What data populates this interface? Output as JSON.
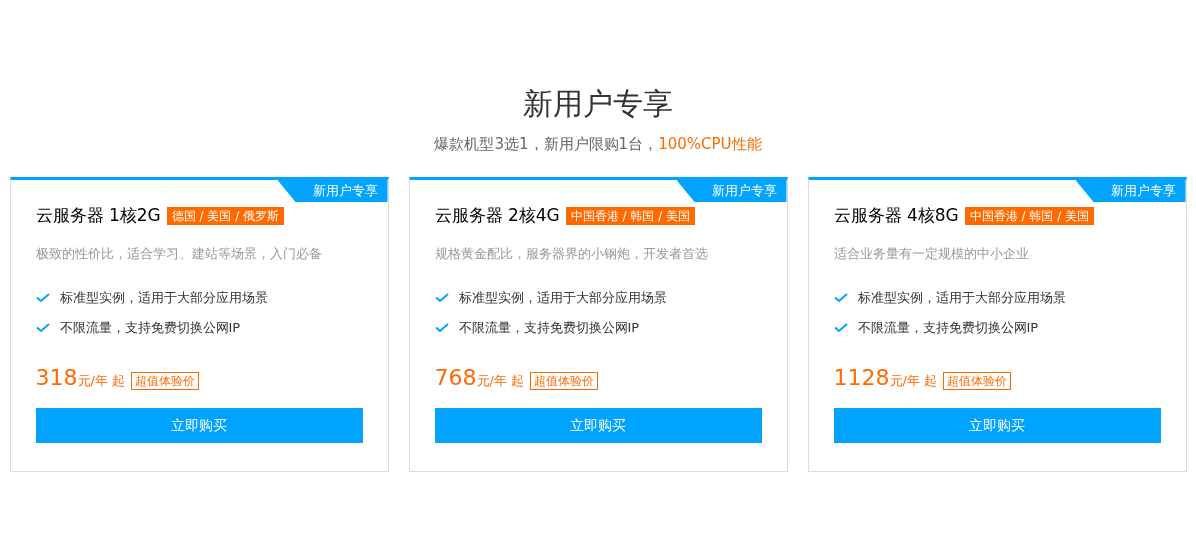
{
  "header": {
    "title": "新用户专享",
    "subtitle": "爆款机型3选1，新用户限购1台，",
    "subtitle_highlight": "100%CPU性能"
  },
  "plans": [
    {
      "ribbon": "新用户专享",
      "name": "云服务器 1核2G",
      "regions": "德国 / 美国 / 俄罗斯",
      "description": "极致的性价比，适合学习、建站等场景，入门必备",
      "features": [
        "标准型实例，适用于大部分应用场景",
        "不限流量，支持免费切换公网IP"
      ],
      "price": "318",
      "unit": "元/年 起",
      "price_tag": "超值体验价",
      "button": "立即购买"
    },
    {
      "ribbon": "新用户专享",
      "name": "云服务器 2核4G",
      "regions": "中国香港 / 韩国 / 美国",
      "description": "规格黄金配比，服务器界的小钢炮，开发者首选",
      "features": [
        "标准型实例，适用于大部分应用场景",
        "不限流量，支持免费切换公网IP"
      ],
      "price": "768",
      "unit": "元/年 起",
      "price_tag": "超值体验价",
      "button": "立即购买"
    },
    {
      "ribbon": "新用户专享",
      "name": "云服务器 4核8G",
      "regions": "中国香港 / 韩国 / 美国",
      "description": "适合业务量有一定规模的中小企业",
      "features": [
        "标准型实例，适用于大部分应用场景",
        "不限流量，支持免费切换公网IP"
      ],
      "price": "1128",
      "unit": "元/年 起",
      "price_tag": "超值体验价",
      "button": "立即购买"
    }
  ]
}
